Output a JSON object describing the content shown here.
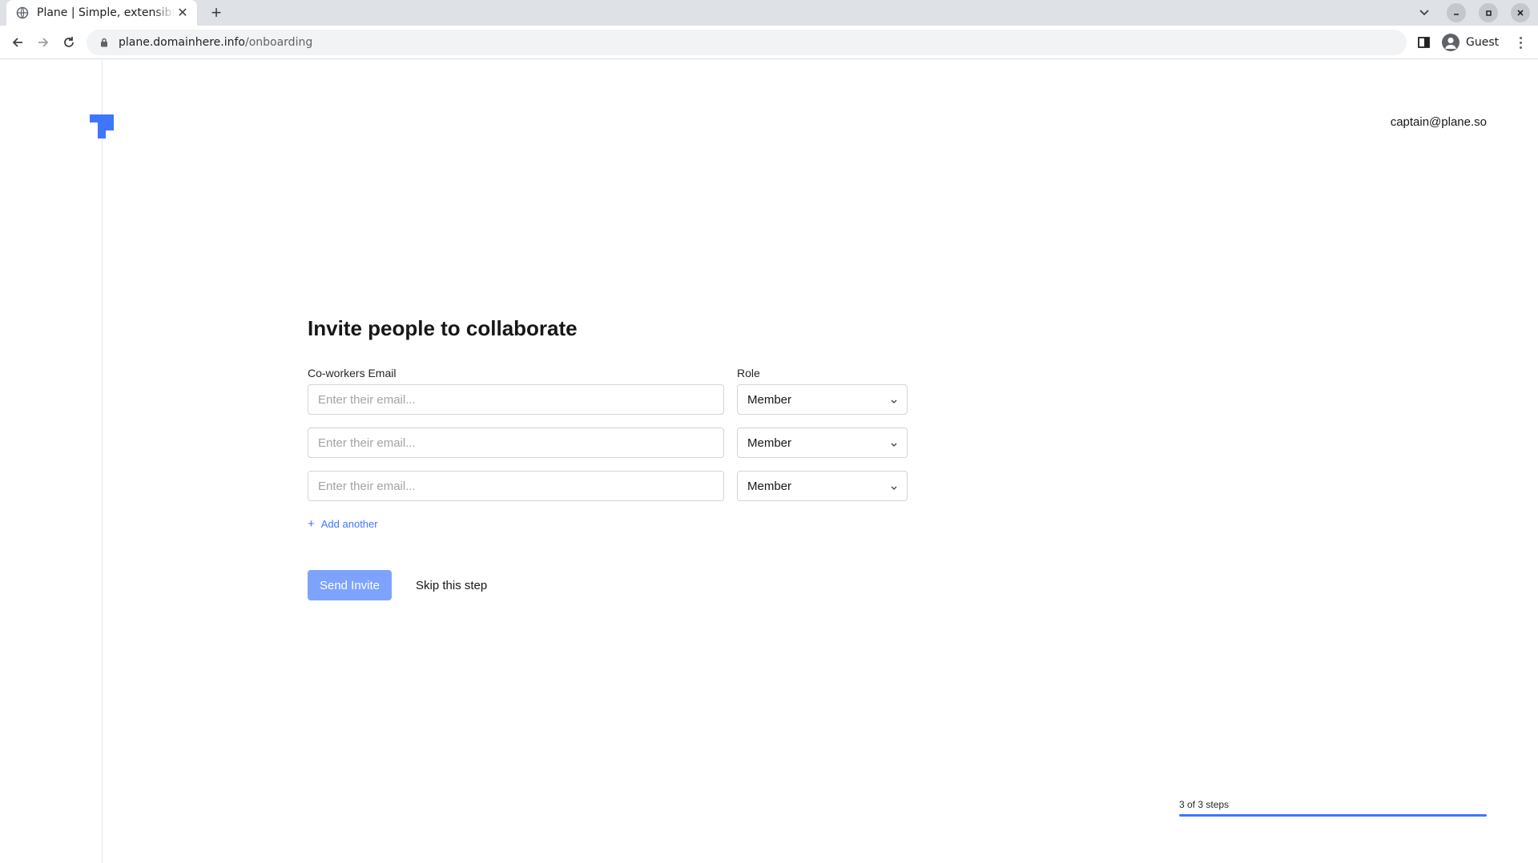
{
  "browser": {
    "tab_title": "Plane | Simple, extensible",
    "url_domain": "plane.domainhere.info",
    "url_path": "/onboarding",
    "profile_label": "Guest"
  },
  "header": {
    "user_email": "captain@plane.so"
  },
  "main": {
    "title": "Invite people to collaborate",
    "email_label": "Co-workers Email",
    "role_label": "Role",
    "rows": [
      {
        "email_value": "",
        "email_placeholder": "Enter their email...",
        "role": "Member"
      },
      {
        "email_value": "",
        "email_placeholder": "Enter their email...",
        "role": "Member"
      },
      {
        "email_value": "",
        "email_placeholder": "Enter their email...",
        "role": "Member"
      }
    ],
    "add_another_label": "Add another",
    "send_invite_label": "Send Invite",
    "skip_label": "Skip this step"
  },
  "progress": {
    "label": "3 of 3 steps",
    "current_step": 3,
    "total_steps": 3,
    "fraction": 1.0
  },
  "colors": {
    "accent": "#3f76ff",
    "button_disabled": "#7ea3ff"
  }
}
